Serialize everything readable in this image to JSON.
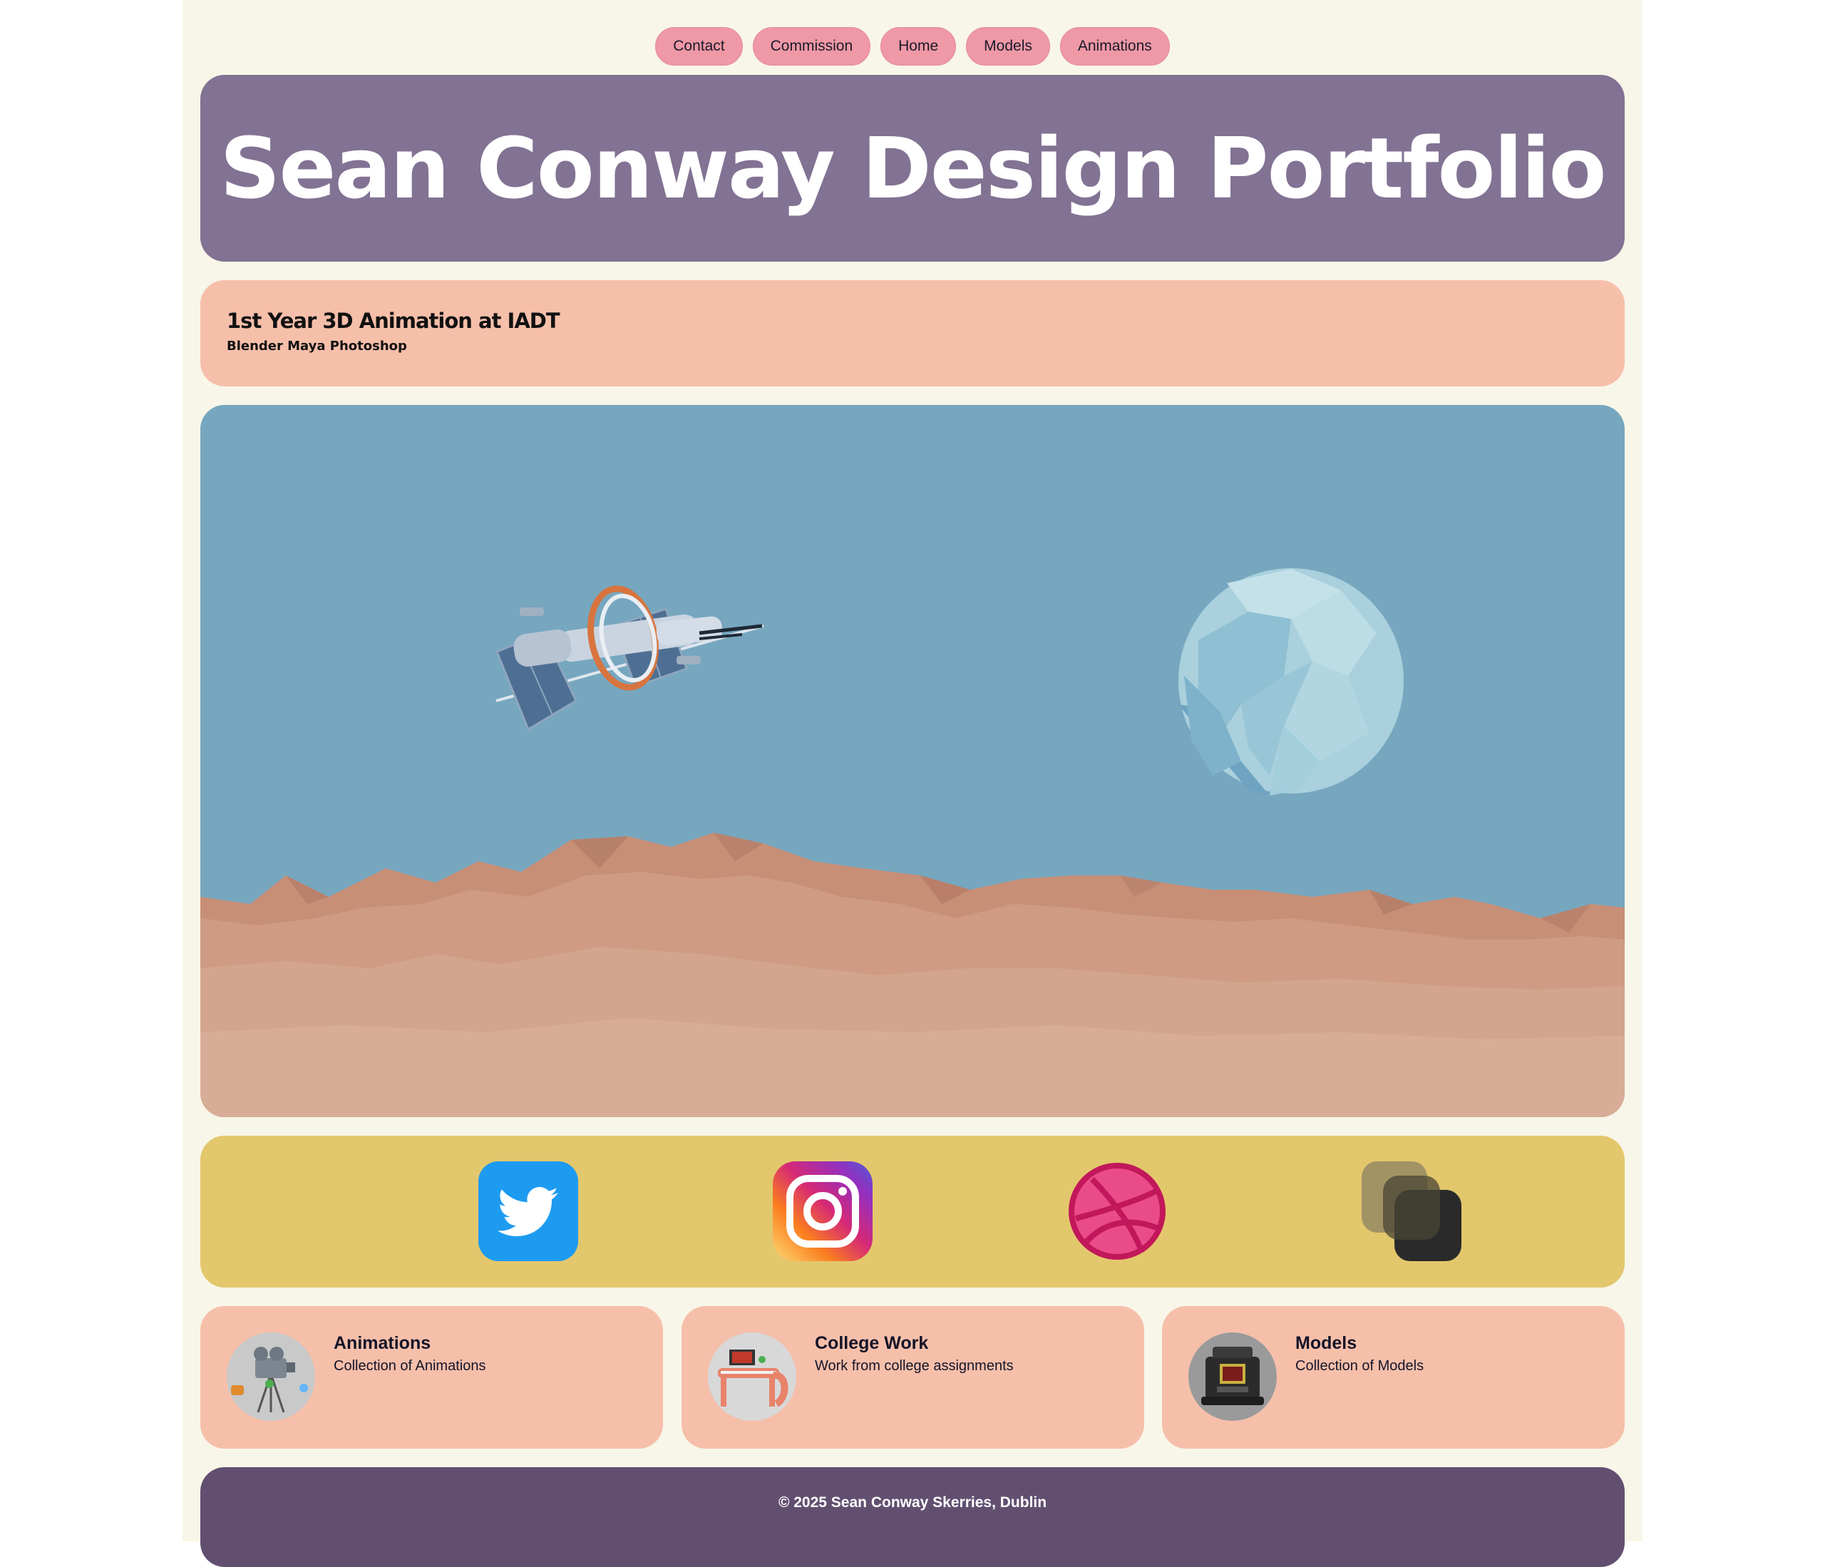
{
  "nav": {
    "items": [
      {
        "label": "Contact"
      },
      {
        "label": "Commission"
      },
      {
        "label": "Home"
      },
      {
        "label": "Models"
      },
      {
        "label": "Animations"
      }
    ]
  },
  "hero": {
    "title": "Sean Conway Design Portfolio"
  },
  "info": {
    "heading": "1st Year 3D Animation at IADT",
    "tools": "Blender Maya Photoshop"
  },
  "scene": {
    "icons": [
      "satellite-illustration",
      "moon-illustration",
      "desert-mountains"
    ]
  },
  "social": {
    "icons": [
      "twitter-icon",
      "instagram-icon",
      "dribbble-icon",
      "layers-icon"
    ]
  },
  "tiles": [
    {
      "title": "Animations",
      "desc": "Collection of Animations",
      "icon": "camera-thumbnail"
    },
    {
      "title": "College Work",
      "desc": "Work from college assignments",
      "icon": "desk-thumbnail"
    },
    {
      "title": "Models",
      "desc": "Collection of Models",
      "icon": "robot-thumbnail"
    }
  ],
  "footer": {
    "text": "© 2025 Sean Conway Skerries, Dublin"
  },
  "colors": {
    "page_bg": "#f8f6e8",
    "nav_pill": "#ef98a6",
    "hero": "#827293",
    "info": "#f6bfaa",
    "sky": "#76a7bf",
    "social": "#e3c76d",
    "footer": "#624f70"
  }
}
